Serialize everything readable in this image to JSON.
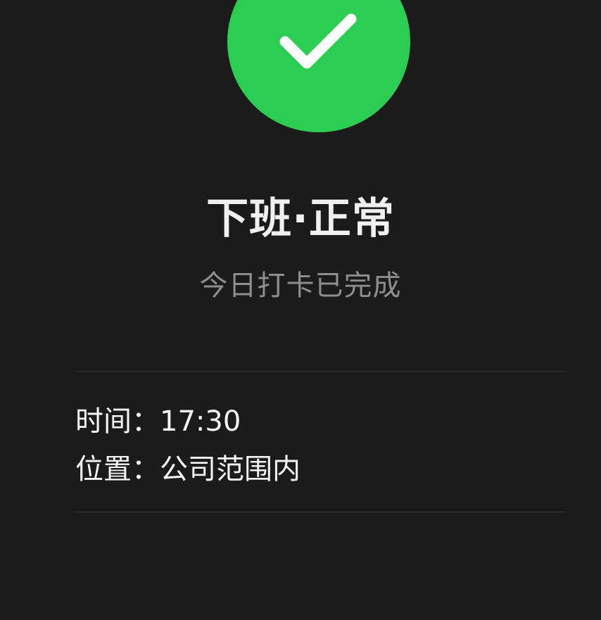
{
  "status": {
    "icon": "checkmark-icon",
    "icon_color": "#2bcd53",
    "title": "下班·正常",
    "subtitle": "今日打卡已完成"
  },
  "details": {
    "time_label": "时间：",
    "time_value": "17:30",
    "location_label": "位置：",
    "location_value": "公司范围内"
  },
  "colors": {
    "background": "#1b1b1b",
    "primary_text": "#f2f2f2",
    "secondary_text": "#8e8e8e",
    "divider": "#343434"
  }
}
